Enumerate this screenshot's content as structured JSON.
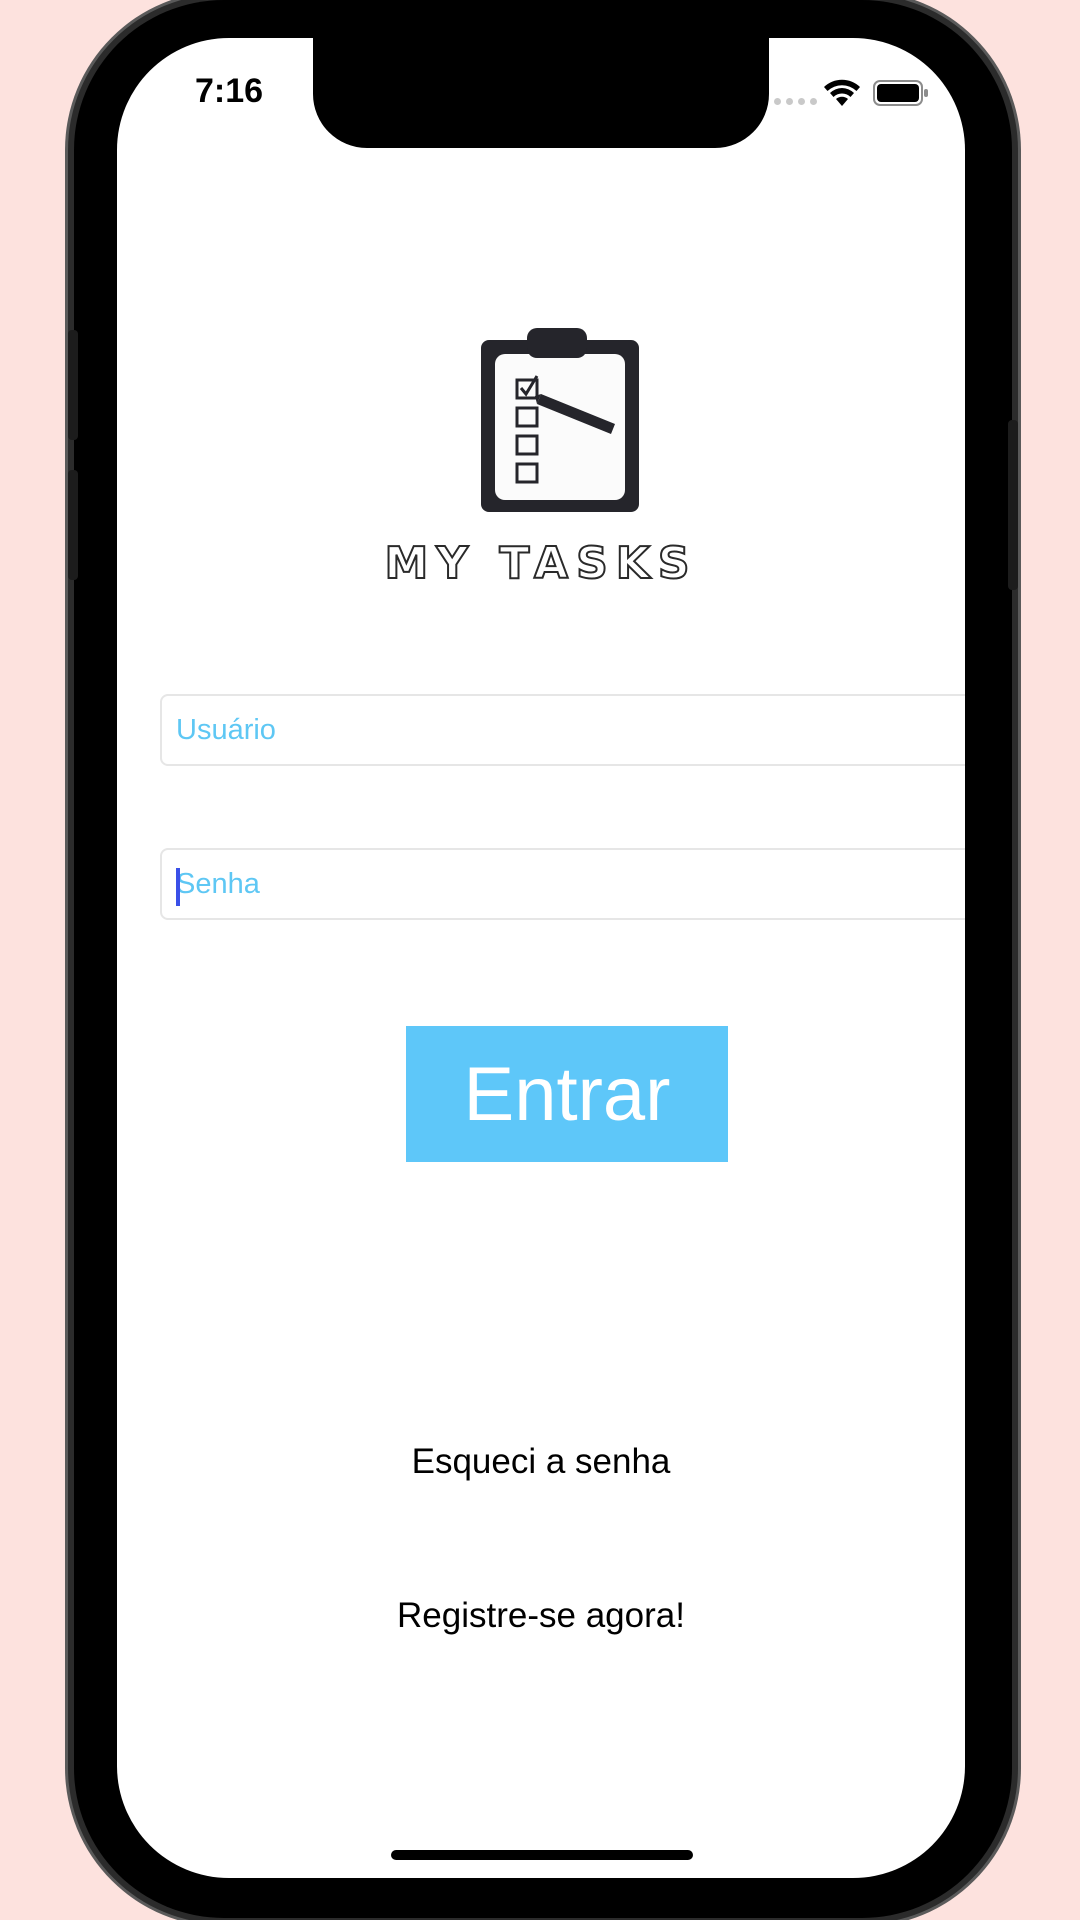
{
  "status_bar": {
    "time": "7:16"
  },
  "logo": {
    "text": "MY TASKS",
    "icon": "clipboard-checklist-icon"
  },
  "form": {
    "username_placeholder": "Usuário",
    "username_value": "",
    "password_placeholder": "Senha",
    "password_value": "",
    "submit_label": "Entrar"
  },
  "links": {
    "forgot_password": "Esqueci a senha",
    "register": "Registre-se agora!"
  },
  "colors": {
    "background": "#fde2de",
    "accent": "#5ec7f9",
    "placeholder": "#5ec7f4",
    "caret": "#3a50e8"
  }
}
